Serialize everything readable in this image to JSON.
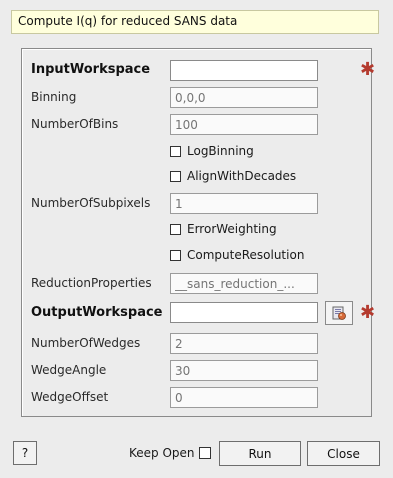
{
  "description": "Compute I(q) for reduced SANS data",
  "fields": {
    "input_workspace": {
      "label": "InputWorkspace",
      "value": "",
      "placeholder": ""
    },
    "binning": {
      "label": "Binning",
      "value": "",
      "placeholder": "0,0,0"
    },
    "number_of_bins": {
      "label": "NumberOfBins",
      "value": "",
      "placeholder": "100"
    },
    "number_of_subpixels": {
      "label": "NumberOfSubpixels",
      "value": "",
      "placeholder": "1"
    },
    "reduction_properties": {
      "label": "ReductionProperties",
      "value": "",
      "placeholder": "__sans_reduction_..."
    },
    "output_workspace": {
      "label": "OutputWorkspace",
      "value": "",
      "placeholder": ""
    },
    "number_of_wedges": {
      "label": "NumberOfWedges",
      "value": "",
      "placeholder": "2"
    },
    "wedge_angle": {
      "label": "WedgeAngle",
      "value": "",
      "placeholder": "30"
    },
    "wedge_offset": {
      "label": "WedgeOffset",
      "value": "",
      "placeholder": "0"
    }
  },
  "checkboxes": {
    "log_binning": {
      "label": "LogBinning",
      "checked": false
    },
    "align_with_decades": {
      "label": "AlignWithDecades",
      "checked": false
    },
    "error_weighting": {
      "label": "ErrorWeighting",
      "checked": false
    },
    "compute_resolution": {
      "label": "ComputeResolution",
      "checked": false
    }
  },
  "footer": {
    "help_label": "?",
    "keep_open_label": "Keep Open",
    "keep_open_checked": false,
    "run_label": "Run",
    "close_label": "Close"
  },
  "icons": {
    "required_marker": "required-star-icon",
    "browse_workspace": "workspace-browse-icon"
  },
  "colors": {
    "required_marker": "#b43a2e",
    "description_background": "#ffffdc"
  }
}
